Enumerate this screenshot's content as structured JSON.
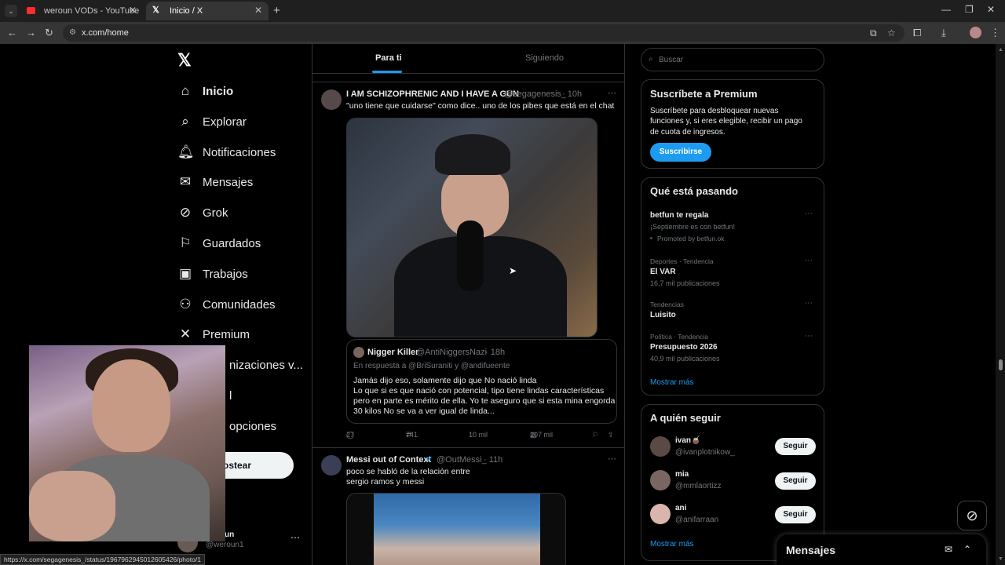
{
  "browser": {
    "tabs": [
      {
        "title": "weroun VODs - YouTube"
      },
      {
        "title": "Inicio / X"
      }
    ],
    "url": "x.com/home",
    "status_url": "https://x.com/segagenesis_/status/1967962945012605426/photo/1"
  },
  "sidebar": {
    "items": [
      {
        "label": "Inicio",
        "icon": "home-icon"
      },
      {
        "label": "Explorar",
        "icon": "search-icon"
      },
      {
        "label": "Notificaciones",
        "icon": "bell-icon"
      },
      {
        "label": "Mensajes",
        "icon": "mail-icon"
      },
      {
        "label": "Grok",
        "icon": "grok-icon"
      },
      {
        "label": "Guardados",
        "icon": "bookmark-icon"
      },
      {
        "label": "Trabajos",
        "icon": "briefcase-icon"
      },
      {
        "label": "Comunidades",
        "icon": "people-icon"
      },
      {
        "label": "Premium",
        "icon": "x-icon"
      },
      {
        "label": "nizaciones v...",
        "icon": "lightning-icon"
      },
      {
        "label": "l",
        "icon": "user-icon"
      },
      {
        "label": "opciones",
        "icon": "more-icon"
      }
    ],
    "post_label": "ostear",
    "account": {
      "name": "un",
      "handle": "@weroun1"
    }
  },
  "timeline": {
    "tabs": [
      "Para ti",
      "Siguiendo"
    ],
    "tweets": [
      {
        "name": "I AM SCHIZOPHRENIC AND I HAVE A GUN",
        "handle": "@segagenesis_",
        "time": "· 10h",
        "text": "\"uno tiene que cuidarse\" como dice.. uno de los pibes que está en el chat",
        "quote": {
          "name": "Nigger Killer",
          "handle": "@AntiNiggersNazi",
          "time": "· 18h",
          "reply_to": "En respuesta a @BriSuraniti y @andifueente",
          "lines": [
            "Jamás dijo eso, solamente dijo que No nació linda",
            "Lo que si es que nació con potencial, tipo tiene lindas características",
            "pero en parte es mérito de ella. Yo te aseguro que si esta mina engorda",
            "30 kilos No se va a ver igual de linda..."
          ]
        },
        "replies": "27",
        "reposts": "741",
        "likes": "10 mil",
        "views": "207 mil"
      },
      {
        "name": "Messi out of Context",
        "handle": "@OutMessi_",
        "time": "· 11h",
        "lines": [
          "poco se habló de la relación entre",
          "sergio ramos y messi"
        ]
      }
    ]
  },
  "right": {
    "search_placeholder": "Buscar",
    "premium": {
      "title": "Suscríbete a Premium",
      "lines": [
        "Suscríbete para desbloquear nuevas",
        "funciones y, si eres elegible, recibir un pago",
        "de cuota de ingresos."
      ],
      "button": "Suscribirse"
    },
    "trends": {
      "title": "Qué está pasando",
      "items": [
        {
          "category": "",
          "name": "betfun te regala",
          "sub": "¡Septiembre es con betfun!",
          "extra": "Promoted by betfun.ok"
        },
        {
          "category": "Deportes · Tendencia",
          "name": "El VAR",
          "sub": "16,7 mil publicaciones"
        },
        {
          "category": "Tendencias",
          "name": "Luisito",
          "sub": ""
        },
        {
          "category": "Política · Tendencia",
          "name": "Presupuesto 2026",
          "sub": "40,9 mil publicaciones"
        }
      ],
      "show_more": "Mostrar más"
    },
    "follow": {
      "title": "A quién seguir",
      "items": [
        {
          "name": "ivan🧉",
          "handle": "@ivanplotnikow_",
          "button": "Seguir"
        },
        {
          "name": "mia",
          "handle": "@mmlaortizz",
          "button": "Seguir"
        },
        {
          "name": "ani",
          "handle": "@anifarraan",
          "button": "Seguir"
        }
      ],
      "show_more": "Mostrar más"
    }
  },
  "messages": {
    "title": "Mensajes"
  }
}
